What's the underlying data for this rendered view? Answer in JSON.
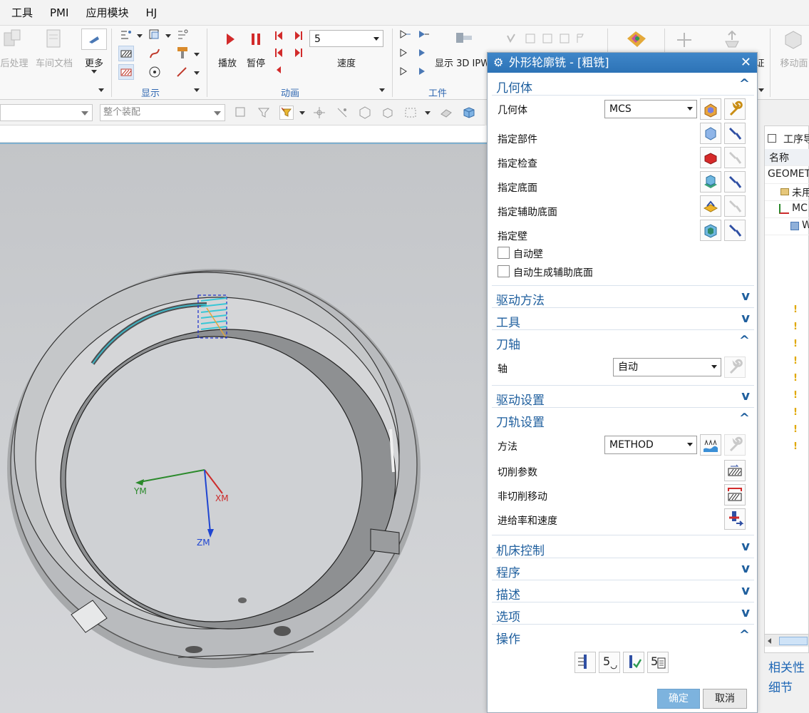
{
  "menu": [
    "工具",
    "PMI",
    "应用模块",
    "HJ"
  ],
  "ribbon": {
    "left_buttons": [
      "后处理",
      "车间文档"
    ],
    "more_label": "更多",
    "group_display": "显示",
    "group_animation": "动画",
    "play_label": "播放",
    "pause_label": "暂停",
    "speed_value": "5",
    "speed_label": "速度",
    "show3d_label": "显示 3D IPW",
    "group_workpiece": "工件",
    "move_label": "移动面",
    "partial_label": "证"
  },
  "selection_bar": {
    "combo1": "",
    "combo2": "整个装配"
  },
  "viewport": {
    "axes": [
      "YM",
      "XM",
      "ZM"
    ]
  },
  "navigator": {
    "header_fragment": "工序导",
    "col_name": "名称",
    "row_geometry": "GEOMET",
    "row_unused": "未用",
    "row_mcs": "MC",
    "row_w": "W",
    "link1": "相关性",
    "link2": "细节"
  },
  "dialog": {
    "title": "外形轮廓铣 - [粗铣]",
    "sections": {
      "geometry": "几何体",
      "drive_method": "驱动方法",
      "tool": "工具",
      "tool_axis": "刀轴",
      "drive_settings": "驱动设置",
      "path_settings": "刀轨设置",
      "machine_control": "机床控制",
      "program": "程序",
      "description": "描述",
      "options": "选项",
      "actions": "操作"
    },
    "geometry_label": "几何体",
    "geometry_value": "MCS",
    "specify_part": "指定部件",
    "specify_check": "指定检查",
    "specify_floor": "指定底面",
    "specify_aux_floor": "指定辅助底面",
    "specify_wall": "指定壁",
    "auto_wall": "自动壁",
    "auto_aux_floor": "自动生成辅助底面",
    "axis_label": "轴",
    "axis_value": "自动",
    "method_label": "方法",
    "method_value": "METHOD",
    "cut_params": "切削参数",
    "non_cut_moves": "非切削移动",
    "feeds_speeds": "进给率和速度",
    "ok_label": "确定",
    "cancel_label": "取消"
  }
}
